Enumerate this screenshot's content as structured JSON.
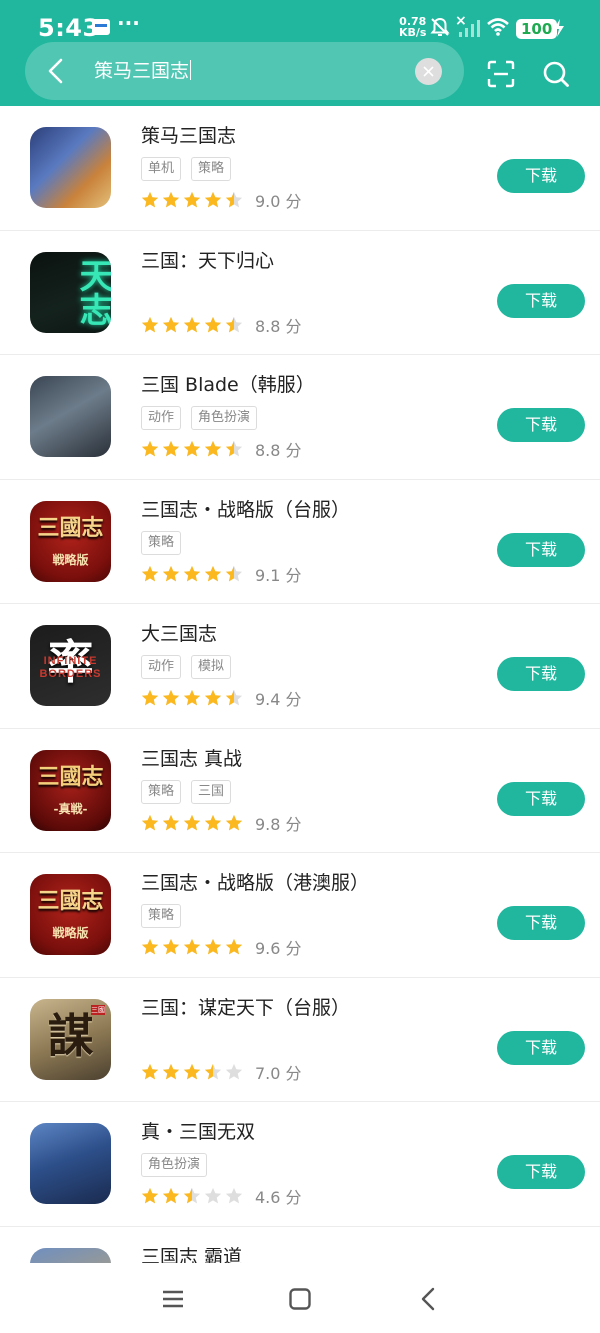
{
  "status_bar": {
    "time": "5:43",
    "dots": "···",
    "net_speed_value": "0.78",
    "net_speed_unit": "KB/s",
    "sim_x": "×",
    "battery": "100",
    "icons": [
      "wallet-icon",
      "bell-muted-icon",
      "signal-icon",
      "wifi-icon",
      "battery-icon",
      "charging-icon"
    ]
  },
  "search": {
    "query": "策马三国志",
    "icons": [
      "back-arrow-icon",
      "clear-icon",
      "scan-icon",
      "search-icon"
    ]
  },
  "colors": {
    "accent": "#20b79e",
    "star": "#fbb91f",
    "star_empty": "#dedede"
  },
  "results": [
    {
      "name": "策马三国志",
      "tags": [
        "单机",
        "策略"
      ],
      "stars": 4.5,
      "score": "9.0 分",
      "action": "下载"
    },
    {
      "name": "三国：天下归心",
      "tags": [],
      "stars": 4.5,
      "score": "8.8 分",
      "action": "下载"
    },
    {
      "name": "三国 Blade（韩服）",
      "tags": [
        "动作",
        "角色扮演"
      ],
      "stars": 4.5,
      "score": "8.8 分",
      "action": "下载"
    },
    {
      "name": "三国志・战略版（台服）",
      "tags": [
        "策略"
      ],
      "stars": 4.5,
      "score": "9.1 分",
      "action": "下载"
    },
    {
      "name": "大三国志",
      "tags": [
        "动作",
        "模拟"
      ],
      "stars": 4.5,
      "score": "9.4 分",
      "action": "下载"
    },
    {
      "name": "三国志 真战",
      "tags": [
        "策略",
        "三国"
      ],
      "stars": 5,
      "score": "9.8 分",
      "action": "下载"
    },
    {
      "name": "三国志・战略版（港澳服）",
      "tags": [
        "策略"
      ],
      "stars": 5,
      "score": "9.6 分",
      "action": "下载"
    },
    {
      "name": "三国：谋定天下（台服）",
      "tags": [],
      "stars": 3.5,
      "score": "7.0 分",
      "action": "下载"
    },
    {
      "name": "真・三国无双",
      "tags": [
        "角色扮演"
      ],
      "stars": 2.5,
      "score": "4.6 分",
      "action": "下载"
    },
    {
      "name": "三国志 霸道",
      "tags": [],
      "stars": null,
      "score": null,
      "action": null
    }
  ],
  "icon_art": [
    {
      "chars": ""
    },
    {
      "chars": "天志"
    },
    {
      "chars": ""
    },
    {
      "chars": "三國志",
      "sub": "戦略版"
    },
    {
      "chars": "率",
      "letters": "INFINITE BORDERS"
    },
    {
      "chars": "三國志",
      "sub": "-真戦-"
    },
    {
      "chars": "三國志",
      "sub": "戦略版"
    },
    {
      "chars": "謀",
      "badge": "三國"
    },
    {
      "chars": ""
    },
    {
      "chars": ""
    }
  ],
  "nav_bar": {
    "icons": [
      "menu-icon",
      "home-icon",
      "back-icon"
    ]
  }
}
